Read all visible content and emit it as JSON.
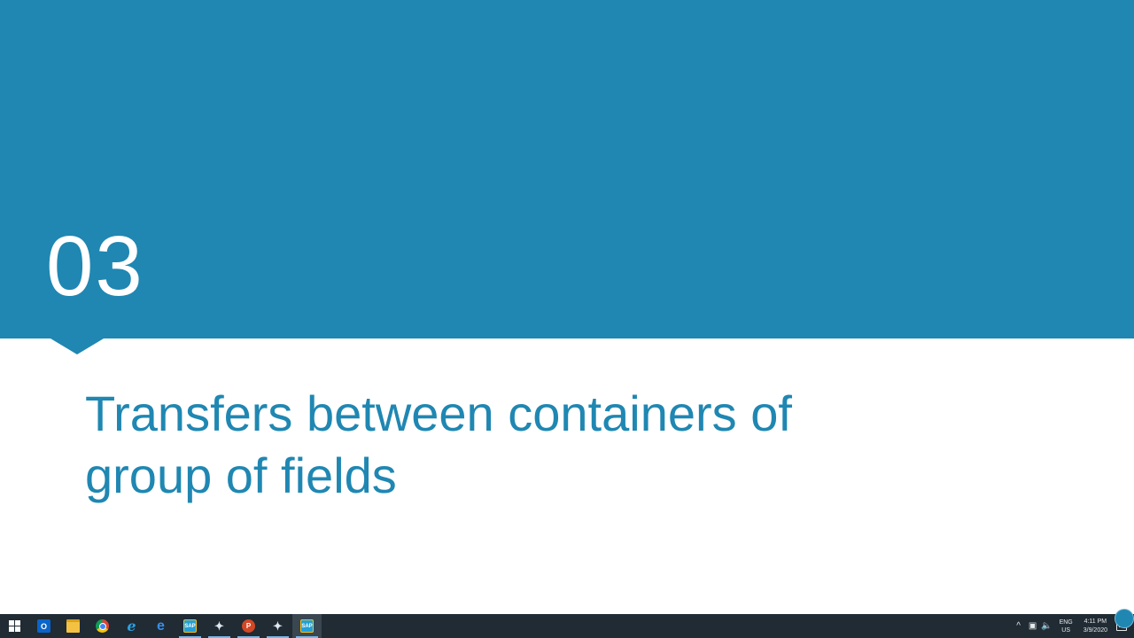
{
  "slide": {
    "number": "03",
    "title_lines": [
      "Transfers between containers of",
      "group of fields"
    ],
    "colors": {
      "accent": "#1f87b2",
      "background": "#ffffff",
      "number_text": "#ffffff"
    }
  },
  "taskbar": {
    "apps": [
      {
        "name": "start-icon",
        "running": false
      },
      {
        "name": "outlook-icon",
        "label": "O",
        "running": false
      },
      {
        "name": "file-explorer-icon",
        "running": false
      },
      {
        "name": "chrome-icon",
        "running": false
      },
      {
        "name": "internet-explorer-icon",
        "label": "e",
        "running": false
      },
      {
        "name": "edge-icon",
        "label": "e",
        "running": false
      },
      {
        "name": "sap-logon-icon",
        "label": "SAP",
        "running": true
      },
      {
        "name": "sap-gui-icon",
        "running": true
      },
      {
        "name": "powerpoint-icon",
        "label": "P",
        "running": true
      },
      {
        "name": "sap-gui-icon",
        "running": true
      },
      {
        "name": "sap-logon-icon",
        "label": "SAP",
        "running": true,
        "active": true
      }
    ],
    "tray": {
      "chevron": "^",
      "language_line1": "ENG",
      "language_line2": "US",
      "time": "4:11 PM",
      "date": "3/9/2020"
    }
  }
}
